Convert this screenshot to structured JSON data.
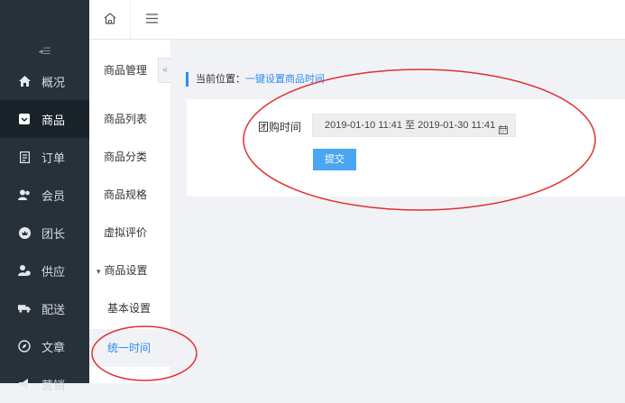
{
  "sidebar": {
    "collapse_glyph": "◂☰",
    "items": [
      {
        "label": "概况",
        "icon": "home-icon"
      },
      {
        "label": "商品",
        "icon": "product-icon"
      },
      {
        "label": "订单",
        "icon": "order-icon"
      },
      {
        "label": "会员",
        "icon": "member-icon"
      },
      {
        "label": "团长",
        "icon": "leader-icon"
      },
      {
        "label": "供应",
        "icon": "supplier-icon"
      },
      {
        "label": "配送",
        "icon": "delivery-icon"
      },
      {
        "label": "文章",
        "icon": "article-icon"
      },
      {
        "label": "营销",
        "icon": "marketing-icon"
      }
    ],
    "active_index": 1
  },
  "topbar": {
    "home_icon": "home-icon",
    "menu_icon": "hamburger-icon"
  },
  "subnav": {
    "title": "商品管理",
    "collapse_glyph": "«",
    "items": [
      {
        "label": "商品列表"
      },
      {
        "label": "商品分类"
      },
      {
        "label": "商品规格"
      },
      {
        "label": "虚拟评价"
      },
      {
        "label": "商品设置"
      },
      {
        "label": "基本设置"
      },
      {
        "label": "统一时间"
      }
    ],
    "group_caret": "▾",
    "active_label": "统一时间"
  },
  "breadcrumb": {
    "prefix": "当前位置：",
    "current": "一键设置商品时间"
  },
  "form": {
    "label": "团购时间",
    "date_range": "2019-01-10 11:41 至 2019-01-30 11:41",
    "calendar_icon": "calendar-icon",
    "submit_label": "提交"
  },
  "annotation_color": "#e03030",
  "accent_color": "#2d8cf0"
}
